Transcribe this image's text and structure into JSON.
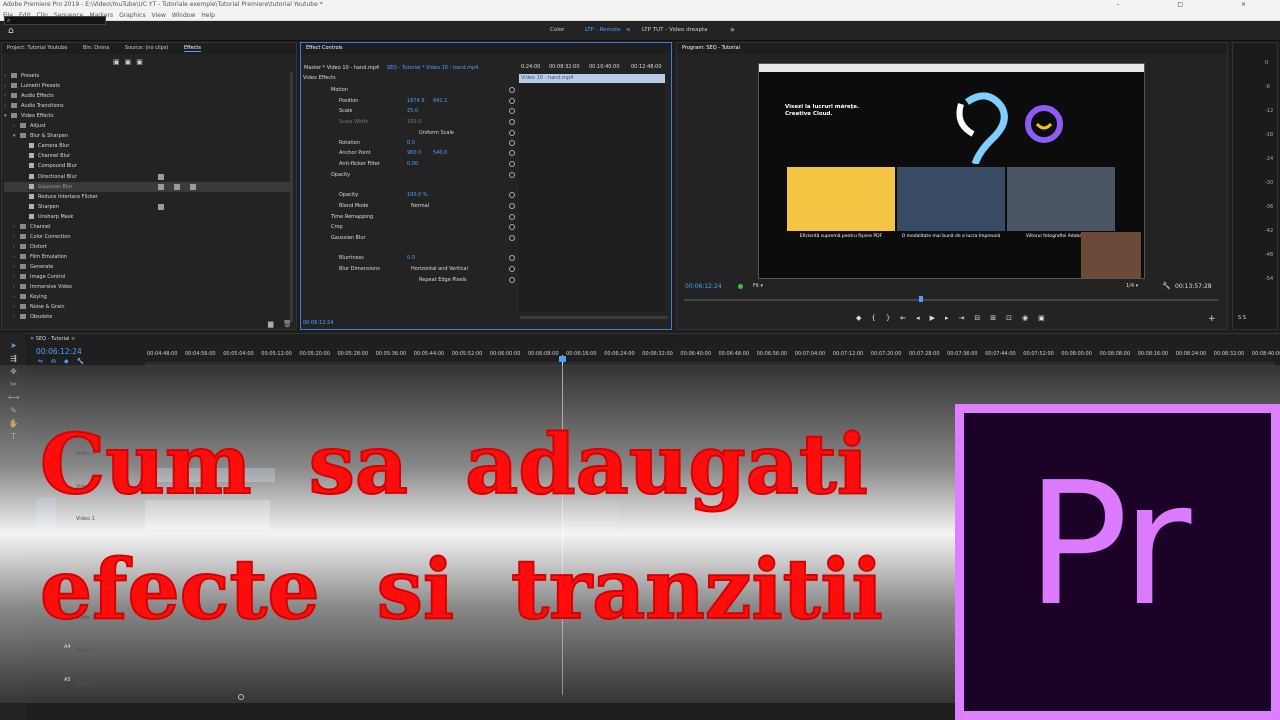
{
  "window": {
    "title": "Adobe Premiere Pro 2019 - E:\\Video\\YouTube\\UC YT - Tutoriale exemple\\Tutorial Premiere\\tutorial Youtube *",
    "controls": "– □ ×"
  },
  "menu": [
    "File",
    "Edit",
    "Clip",
    "Sequence",
    "Markers",
    "Graphics",
    "View",
    "Window",
    "Help"
  ],
  "workspaces": {
    "items": [
      "Color",
      "LTP - Remote",
      "LTP TUT - Video dreapta"
    ],
    "active": "LTP - Remote",
    "more": "»"
  },
  "effects_panel": {
    "tabs": [
      "Project: Tutorial Youtube",
      "Bin: Drona",
      "Source: (no clips)",
      "Effects"
    ],
    "search_value": "",
    "tree": [
      {
        "label": "Presets",
        "level": 0,
        "type": "folder"
      },
      {
        "label": "Lumetri Presets",
        "level": 0,
        "type": "folder"
      },
      {
        "label": "Audio Effects",
        "level": 0,
        "type": "folder"
      },
      {
        "label": "Audio Transitions",
        "level": 0,
        "type": "folder"
      },
      {
        "label": "Video Effects",
        "level": 0,
        "type": "folder",
        "open": true
      },
      {
        "label": "Adjust",
        "level": 1,
        "type": "folder"
      },
      {
        "label": "Blur & Sharpen",
        "level": 1,
        "type": "folder",
        "open": true
      },
      {
        "label": "Camera Blur",
        "level": 2,
        "type": "effect"
      },
      {
        "label": "Channel Blur",
        "level": 2,
        "type": "effect"
      },
      {
        "label": "Compound Blur",
        "level": 2,
        "type": "effect"
      },
      {
        "label": "Directional Blur",
        "level": 2,
        "type": "effect"
      },
      {
        "label": "Gaussian Blur",
        "level": 2,
        "type": "effect",
        "selected": true
      },
      {
        "label": "Reduce Interlace Flicker",
        "level": 2,
        "type": "effect"
      },
      {
        "label": "Sharpen",
        "level": 2,
        "type": "effect"
      },
      {
        "label": "Unsharp Mask",
        "level": 2,
        "type": "effect"
      },
      {
        "label": "Channel",
        "level": 1,
        "type": "folder"
      },
      {
        "label": "Color Correction",
        "level": 1,
        "type": "folder"
      },
      {
        "label": "Distort",
        "level": 1,
        "type": "folder"
      },
      {
        "label": "Film Emulation",
        "level": 1,
        "type": "folder"
      },
      {
        "label": "Generate",
        "level": 1,
        "type": "folder"
      },
      {
        "label": "Image Control",
        "level": 1,
        "type": "folder"
      },
      {
        "label": "Immersive Video",
        "level": 1,
        "type": "folder"
      },
      {
        "label": "Keying",
        "level": 1,
        "type": "folder"
      },
      {
        "label": "Noise & Grain",
        "level": 1,
        "type": "folder"
      },
      {
        "label": "Obsolete",
        "level": 1,
        "type": "folder"
      }
    ]
  },
  "effect_controls": {
    "tab": "Effect Controls",
    "master": "Master * Video 10 - hand.mp4",
    "sequence_clip": "SEQ - Tutorial * Video 10 - hand.mp4",
    "ruler": [
      "0:24:00",
      "00:08:32:00",
      "00:10:40:00",
      "00:12:48:00"
    ],
    "clip_bar": "Video 10 - hand.mp4",
    "section": "Video Effects",
    "rows": [
      {
        "label": "Motion",
        "values": []
      },
      {
        "label": "Position",
        "values": [
          "1674.9",
          "942.2"
        ]
      },
      {
        "label": "Scale",
        "values": [
          "25.0"
        ]
      },
      {
        "label": "Scale Width",
        "values": [
          "100.0"
        ]
      },
      {
        "label": "Uniform Scale",
        "values": []
      },
      {
        "label": "Rotation",
        "values": [
          "0.0"
        ]
      },
      {
        "label": "Anchor Point",
        "values": [
          "960.0",
          "540.0"
        ]
      },
      {
        "label": "Anti-flicker Filter",
        "values": [
          "0.00"
        ]
      },
      {
        "label": "Opacity",
        "values": []
      },
      {
        "label": "Opacity",
        "values": [
          "100.0 %"
        ]
      },
      {
        "label": "Blend Mode",
        "values": [
          "Normal"
        ]
      },
      {
        "label": "Time Remapping",
        "values": []
      },
      {
        "label": "Crop",
        "values": []
      },
      {
        "label": "Gaussian Blur",
        "values": []
      },
      {
        "label": "Blurriness",
        "values": [
          "0.0"
        ]
      },
      {
        "label": "Blur Dimensions",
        "values": [
          "Horizontal and Vertical"
        ]
      },
      {
        "label": "Repeat Edge Pixels",
        "values": []
      }
    ],
    "timecode": "00:06:12:24"
  },
  "program_monitor": {
    "tab": "Program: SEQ - Tutorial",
    "timecode": "00:06:12:24",
    "fit": "Fit",
    "resolution": "1/4",
    "duration": "00:13:57:28",
    "web_heading": "Visezi la lucruri măreţe. Creative Cloud.",
    "cards": [
      "Eficientă supremă pentru fişiere PDF",
      "O modalitate mai bună de a lucra împreună",
      "Viitorul fotografiei Adobe, din..."
    ]
  },
  "meters": {
    "scale": [
      "0",
      "-6",
      "-12",
      "-18",
      "-24",
      "-30",
      "-36",
      "-42",
      "-48",
      "-54"
    ],
    "solo": "S S"
  },
  "timeline": {
    "tab": "SEQ - Tutorial",
    "timecode": "00:06:12:24",
    "ruler": [
      "00:04:48:00",
      "00:04:56:00",
      "00:05:04:00",
      "00:05:12:00",
      "00:05:20:00",
      "00:05:28:00",
      "00:05:36:00",
      "00:05:44:00",
      "00:05:52:00",
      "00:06:00:00",
      "00:06:08:00",
      "00:06:16:00",
      "00:06:24:00",
      "00:06:32:00",
      "00:06:40:00",
      "00:06:48:00",
      "00:06:56:00",
      "00:07:04:00",
      "00:07:12:00",
      "00:07:20:00",
      "00:07:28:00",
      "00:07:36:00",
      "00:07:44:00",
      "00:07:52:00",
      "00:08:00:00",
      "00:08:08:00",
      "00:08:16:00",
      "00:08:24:00",
      "00:08:32:00",
      "00:08:40:00"
    ],
    "tracks": [
      "Video 3",
      "Video 2",
      "Video 1",
      "Audio 1",
      "Audio 4",
      "Audio 5"
    ],
    "audio_labels": [
      "A4",
      "A5"
    ]
  },
  "thumbnail": {
    "line1": "Cum  sa  adaugati",
    "line2": "efecte  si  tranzitii",
    "logo": "Pr",
    "colors": {
      "headline": "#ff0d0d",
      "logo_border": "#dd80ff",
      "logo_text": "#dc7bff",
      "logo_bg": "#1b0226"
    }
  }
}
